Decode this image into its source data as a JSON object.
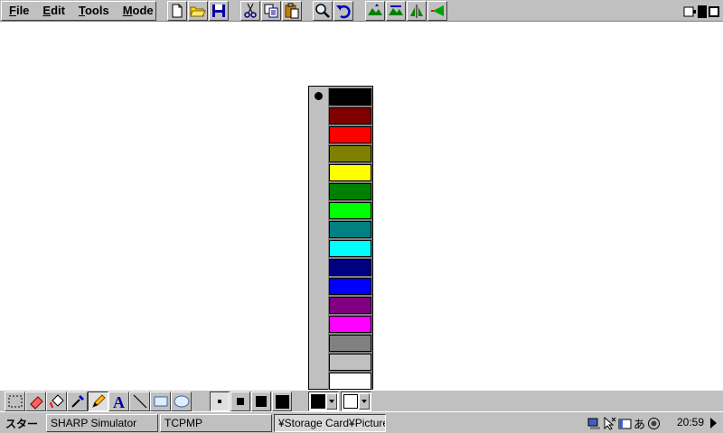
{
  "menu": {
    "items": [
      {
        "label": "File"
      },
      {
        "label": "Edit"
      },
      {
        "label": "Tools"
      },
      {
        "label": "Mode"
      }
    ]
  },
  "toolbar_icons": [
    "new-file-icon",
    "open-folder-icon",
    "save-disk-icon",
    "cut-icon",
    "copy-icon",
    "paste-icon",
    "zoom-icon",
    "undo-icon",
    "flip-up-icon",
    "flip-up-alt-icon",
    "mirror-icon",
    "rotate-left-icon"
  ],
  "palette": {
    "selected_index": 0,
    "colors": [
      "#000000",
      "#800000",
      "#ff0000",
      "#808000",
      "#ffff00",
      "#008000",
      "#00ff00",
      "#008080",
      "#00ffff",
      "#000080",
      "#0000ff",
      "#800080",
      "#ff00ff",
      "#808080",
      "#c0c0c0",
      "#ffffff"
    ]
  },
  "tools": [
    "select-rect-icon",
    "eraser-icon",
    "fill-icon",
    "dropper-icon",
    "pencil-icon",
    "text-icon",
    "line-icon",
    "rectangle-icon",
    "ellipse-icon"
  ],
  "active_tool": "pencil-icon",
  "pen_sizes": [
    "small",
    "medium",
    "large",
    "extra-large"
  ],
  "active_pen_size": "small",
  "foreground_color": "#000000",
  "background_color": "#ffffff",
  "taskbar": {
    "start_label": "スタート",
    "tasks": [
      {
        "label": "SHARP Simulator",
        "active": false
      },
      {
        "label": "TCPMP",
        "active": false
      },
      {
        "label": "¥Storage Card¥Pictures",
        "active": true
      }
    ],
    "clock": "20:59",
    "tray_icons": [
      "network-icon",
      "cursor-icon",
      "keyboard-icon",
      "ime-icon",
      "volume-icon"
    ],
    "ime_label": "あ"
  }
}
